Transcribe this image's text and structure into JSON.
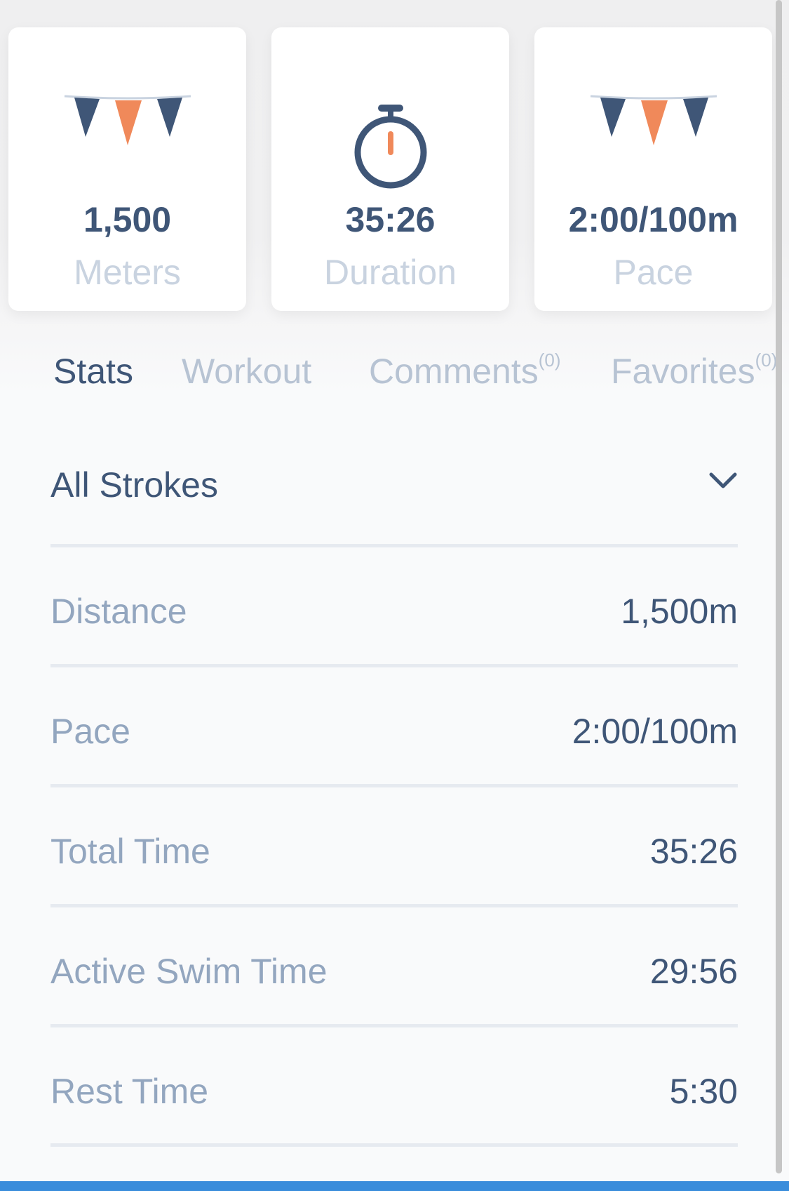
{
  "cards": [
    {
      "icon": "pennant-flags-icon",
      "value": "1,500",
      "label": "Meters"
    },
    {
      "icon": "stopwatch-icon",
      "value": "35:26",
      "label": "Duration"
    },
    {
      "icon": "pennant-flags-icon",
      "value": "2:00/100m",
      "label": "Pace"
    }
  ],
  "tabs": [
    {
      "label": "Stats",
      "count": ""
    },
    {
      "label": "Workout",
      "count": ""
    },
    {
      "label": "Comments",
      "count": "(0)"
    },
    {
      "label": "Favorites",
      "count": "(0)"
    }
  ],
  "selector": {
    "label": "All Strokes",
    "icon": "chevron-down-icon"
  },
  "rows": [
    {
      "label": "Distance",
      "value": "1,500m"
    },
    {
      "label": "Pace",
      "value": "2:00/100m"
    },
    {
      "label": "Total Time",
      "value": "35:26"
    },
    {
      "label": "Active Swim Time",
      "value": "29:56"
    },
    {
      "label": "Rest Time",
      "value": "5:30"
    }
  ],
  "colors": {
    "navy": "#3f5677",
    "orange": "#f0895a",
    "muted_label": "#93a6bf",
    "card_label": "#c9d3e0",
    "divider": "#e6eaf0",
    "accent_bar": "#3a8ddb"
  }
}
